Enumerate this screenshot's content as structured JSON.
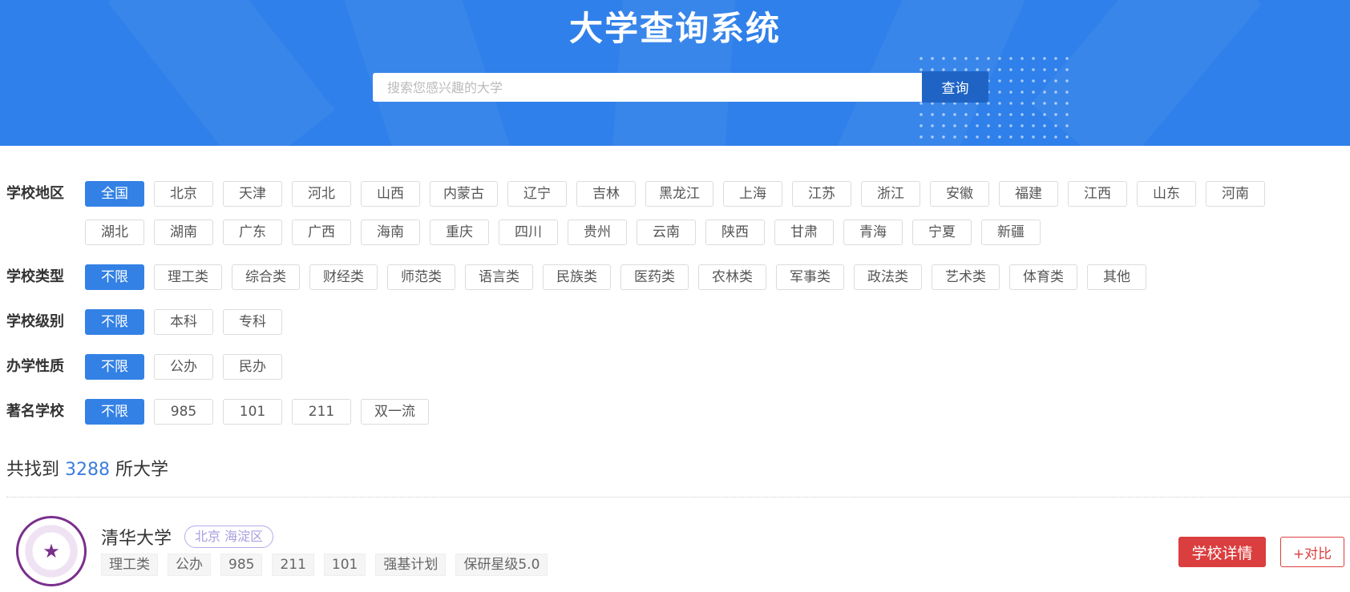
{
  "header": {
    "title": "大学查询系统",
    "search_placeholder": "搜索您感兴趣的大学",
    "search_button": "查询",
    "accent_color": "#2f80ea"
  },
  "filters": {
    "region": {
      "label": "学校地区",
      "options": [
        "全国",
        "北京",
        "天津",
        "河北",
        "山西",
        "内蒙古",
        "辽宁",
        "吉林",
        "黑龙江",
        "上海",
        "江苏",
        "浙江",
        "安徽",
        "福建",
        "江西",
        "山东",
        "河南",
        "湖北",
        "湖南",
        "广东",
        "广西",
        "海南",
        "重庆",
        "四川",
        "贵州",
        "云南",
        "陕西",
        "甘肃",
        "青海",
        "宁夏",
        "新疆"
      ],
      "selected": "全国"
    },
    "type": {
      "label": "学校类型",
      "options": [
        "不限",
        "理工类",
        "综合类",
        "财经类",
        "师范类",
        "语言类",
        "民族类",
        "医药类",
        "农林类",
        "军事类",
        "政法类",
        "艺术类",
        "体育类",
        "其他"
      ],
      "selected": "不限"
    },
    "level": {
      "label": "学校级别",
      "options": [
        "不限",
        "本科",
        "专科"
      ],
      "selected": "不限"
    },
    "nature": {
      "label": "办学性质",
      "options": [
        "不限",
        "公办",
        "民办"
      ],
      "selected": "不限"
    },
    "famous": {
      "label": "著名学校",
      "options": [
        "不限",
        "985",
        "101",
        "211",
        "双一流"
      ],
      "selected": "不限"
    }
  },
  "result": {
    "prefix": "共找到",
    "count": "3288",
    "suffix": "所大学"
  },
  "universities": [
    {
      "name": "清华大学",
      "location": "北京 海淀区",
      "tags": [
        "理工类",
        "公办",
        "985",
        "211",
        "101",
        "强基计划",
        "保研星级5.0"
      ],
      "detail_button": "学校详情",
      "compare_button": "+对比"
    }
  ]
}
